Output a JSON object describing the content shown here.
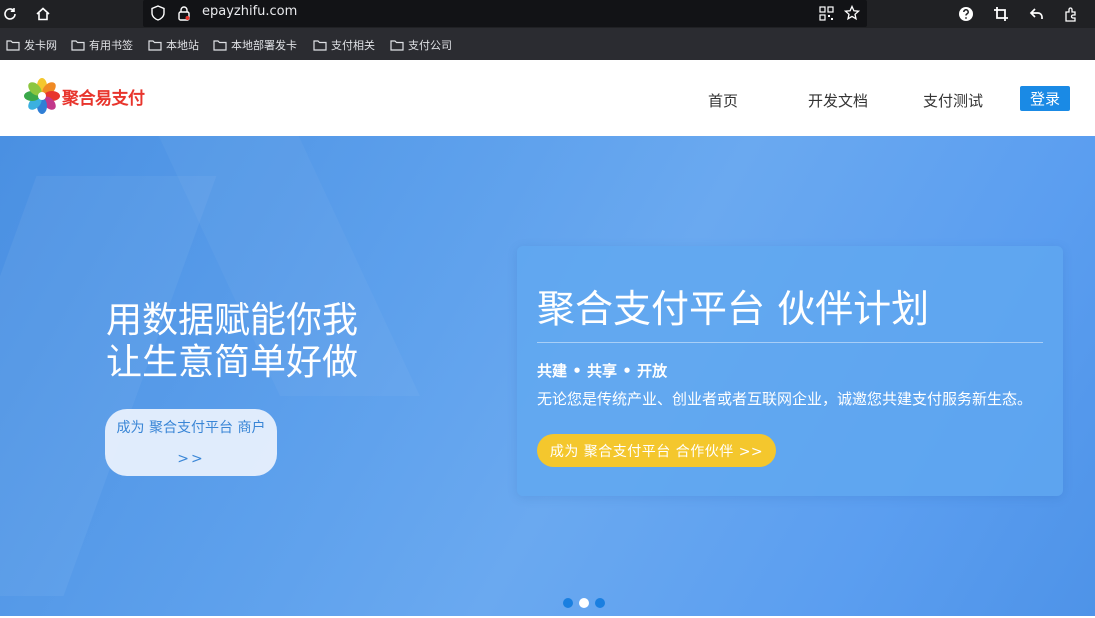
{
  "browser": {
    "url": "epayzhifu.com",
    "bookmarks": [
      "发卡网",
      "有用书签",
      "本地站",
      "本地部署发卡",
      "支付相关",
      "支付公司"
    ]
  },
  "site": {
    "logo_text": "聚合易支付",
    "nav": [
      "首页",
      "开发文档",
      "支付测试"
    ],
    "login_label": "登录"
  },
  "hero": {
    "title_line1": "用数据赋能你我",
    "title_line2": "让生意简单好做",
    "merchant_button_line1": "成为 聚合支付平台 商户",
    "merchant_button_line2": ">>",
    "card": {
      "title": "聚合支付平台 伙伴计划",
      "subtitle": "共建 • 共享 • 开放",
      "description": "无论您是传统产业、创业者或者互联网企业，诚邀您共建支付服务新生态。",
      "button_label": "成为 聚合支付平台 合作伙伴 >>"
    },
    "slides": {
      "count": 3,
      "active": 2
    }
  },
  "colors": {
    "brand_red": "#e8352d",
    "accent_blue": "#1a8ae5",
    "cta_yellow": "#f4c72d"
  }
}
